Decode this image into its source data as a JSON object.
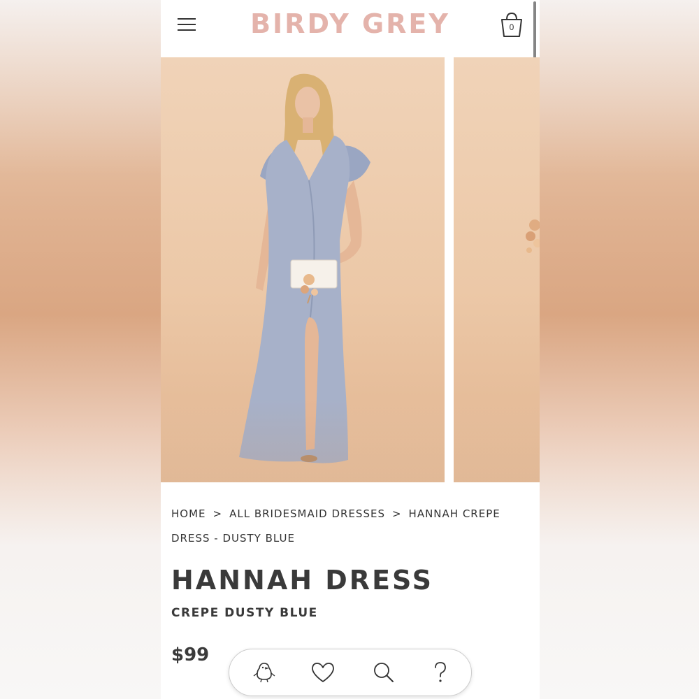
{
  "colors": {
    "brand": "#e4b3ab",
    "text": "#3a3a3a",
    "dress": "#a7b1c9"
  },
  "header": {
    "logo": "BIRDY GREY",
    "cart_count": "0",
    "menu_icon": "hamburger-menu-icon",
    "cart_icon": "shopping-bag-icon"
  },
  "breadcrumb": {
    "home": "HOME",
    "separator": ">",
    "category": "ALL BRIDESMAID DRESSES",
    "current": "HANNAH CREPE DRESS - DUSTY BLUE"
  },
  "product": {
    "name": "HANNAH DRESS",
    "variant": "CREPE DUSTY BLUE",
    "price": "$99"
  },
  "bottom_nav": {
    "items": [
      {
        "icon": "bird-icon"
      },
      {
        "icon": "heart-icon"
      },
      {
        "icon": "search-icon"
      },
      {
        "icon": "help-question-icon"
      }
    ]
  }
}
